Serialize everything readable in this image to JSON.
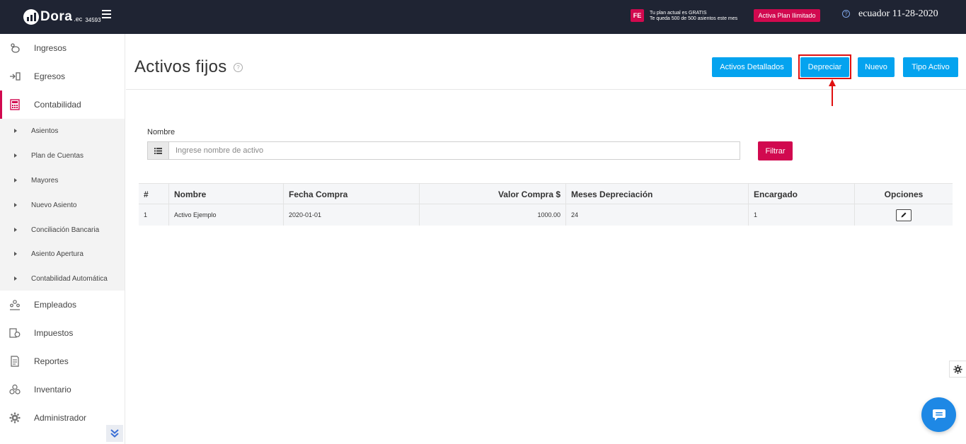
{
  "topbar": {
    "logo_word": "Dora",
    "logo_ec": ".ec",
    "logo_number": "34593",
    "fe_badge": "FE",
    "plan_line1": "Tu plan actual es GRATIS",
    "plan_line2": "Te queda 500 de 500 asientos este mes",
    "plan_button": "Activa Plan Ilimitado",
    "help_glyph": "?",
    "user_date": "ecuador 11-28-2020",
    "colors": {
      "bar": "#1f2433",
      "accent": "#d1094f"
    }
  },
  "sidebar": {
    "items": [
      {
        "label": "Ingresos",
        "icon": "piggy-bank-icon"
      },
      {
        "label": "Egresos",
        "icon": "arrow-out-icon"
      },
      {
        "label": "Contabilidad",
        "icon": "calculator-icon",
        "active": true
      },
      {
        "label": "Empleados",
        "icon": "employees-icon"
      },
      {
        "label": "Impuestos",
        "icon": "taxes-icon"
      },
      {
        "label": "Reportes",
        "icon": "reports-icon"
      },
      {
        "label": "Inventario",
        "icon": "inventory-icon"
      },
      {
        "label": "Administrador",
        "icon": "gear-icon"
      }
    ],
    "subitems": [
      "Asientos",
      "Plan de Cuentas",
      "Mayores",
      "Nuevo Asiento",
      "Conciliación Bancaria",
      "Asiento Apertura",
      "Contabilidad Automática"
    ]
  },
  "page": {
    "title": "Activos fijos",
    "help_glyph": "?",
    "buttons": {
      "detailed": "Activos Detallados",
      "depreciate": "Depreciar",
      "new": "Nuevo",
      "type": "Tipo Activo"
    },
    "colors": {
      "primary": "#04a3ef",
      "danger": "#d1094f",
      "annotation": "#e01010"
    }
  },
  "filter": {
    "label": "Nombre",
    "placeholder": "Ingrese nombre de activo",
    "button": "Filtrar"
  },
  "table": {
    "headers": [
      "#",
      "Nombre",
      "Fecha Compra",
      "Valor Compra $",
      "Meses Depreciación",
      "Encargado",
      "Opciones"
    ],
    "rows": [
      [
        "1",
        "Activo Ejemplo",
        "2020-01-01",
        "1000.00",
        "24",
        "1"
      ]
    ]
  }
}
